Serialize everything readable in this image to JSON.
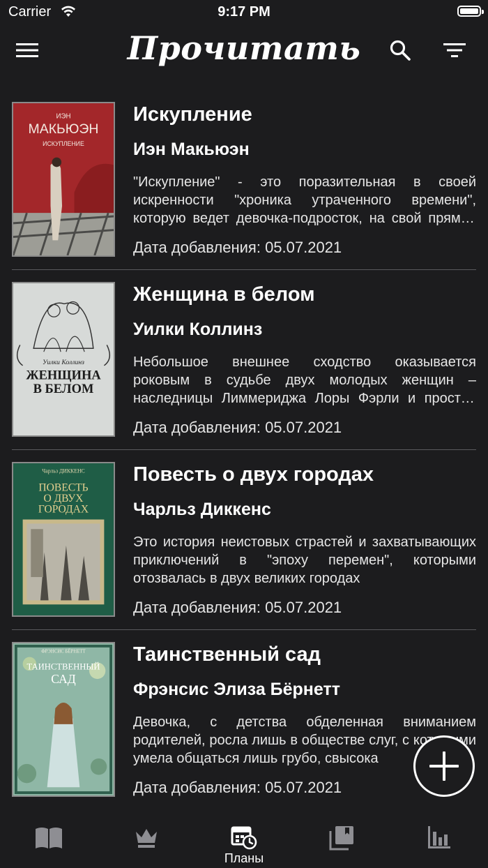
{
  "status_bar": {
    "carrier": "Carrier",
    "time": "9:17 PM"
  },
  "nav": {
    "title": "Прочитать",
    "menu_icon": "hamburger-menu-icon",
    "search_icon": "search-icon",
    "filter_icon": "filter-icon"
  },
  "books": [
    {
      "title": "Искупление",
      "author": "Иэн Макьюэн",
      "description": "\"Искупление\" - это поразительная в своей искренности \"хроника утраченного времени\", которую ведет девочка-подросток, на свой прямой лад",
      "date": "Дата добавления: 05.07.2021",
      "cover_top": "ИЭН",
      "cover_title": "МАКЬЮЭН",
      "cover_sub": "ИСКУПЛЕНИЕ"
    },
    {
      "title": "Женщина в белом",
      "author": "Уилки Коллинз",
      "description": "Небольшое внешнее сходство оказывается роковым в судьбе двух молодых женщин – наследницы Лиммериджа Лоры Фэрли и простой девушки",
      "date": "Дата добавления: 05.07.2021",
      "cover_top": "Уилки Коллинз",
      "cover_title": "ЖЕНЩИНА",
      "cover_sub": "В БЕЛОМ"
    },
    {
      "title": "Повесть о двух городах",
      "author": "Чарльз Диккенс",
      "description": "Это история неистовых страстей и захватывающих приключений в \"эпоху перемен\", которыми отозвалась в двух великих городах",
      "date": "Дата добавления: 05.07.2021",
      "cover_top": "Чарльз ДИККЕНС",
      "cover_title": "ПОВЕСТЬ",
      "cover_sub": "О ДВУХ",
      "cover_sub2": "ГОРОДАХ"
    },
    {
      "title": "Таинственный сад",
      "author": "Фрэнсис Элиза Бёрнетт",
      "description": "Девочка, с детства обделенная вниманием родителей, росла лишь в обществе слуг, с которыми умела общаться лишь грубо, свысока",
      "date": "Дата добавления: 05.07.2021",
      "cover_top": "ФРЭНСИС БЁРНЕТТ",
      "cover_title": "ТАИНСТВЕННЫЙ",
      "cover_sub": "САД"
    }
  ],
  "fab": {
    "icon": "plus-icon"
  },
  "tabs": [
    {
      "icon": "book-icon",
      "label": ""
    },
    {
      "icon": "crown-icon",
      "label": ""
    },
    {
      "icon": "calendar-clock-icon",
      "label": "Планы"
    },
    {
      "icon": "library-icon",
      "label": ""
    },
    {
      "icon": "stats-icon",
      "label": ""
    }
  ],
  "colors": {
    "background": "#1c1c1e",
    "text": "#ffffff",
    "inactive_icon": "#8e8e93",
    "divider": "#5a5a5e"
  }
}
